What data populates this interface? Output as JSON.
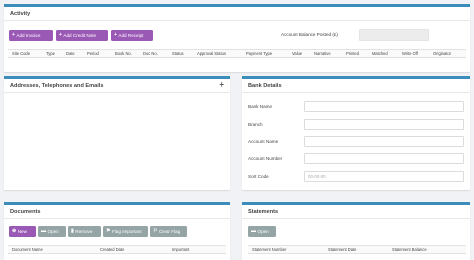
{
  "activity": {
    "title": "Activity",
    "buttons": {
      "add_invoice": "Add Invoice",
      "add_credit_note": "Add Credit Note",
      "add_receipt": "Add Receipt"
    },
    "balance_label": "Account Balance Posted (£)",
    "balance_value": "",
    "columns": [
      "Site Code",
      "Type",
      "Date",
      "Period",
      "Book No.",
      "Doc No.",
      "Status",
      "Approval Status",
      "Payment Type",
      "Value",
      "Narrative",
      "Printed",
      "Matched",
      "Write Off",
      "Originator"
    ]
  },
  "addresses": {
    "title": "Addresses, Telephones and Emails",
    "add_symbol": "+"
  },
  "bank": {
    "title": "Bank Details",
    "fields": [
      {
        "label": "Bank Name",
        "value": "",
        "placeholder": ""
      },
      {
        "label": "Branch",
        "value": "",
        "placeholder": ""
      },
      {
        "label": "Account Name",
        "value": "",
        "placeholder": ""
      },
      {
        "label": "Account Number",
        "value": "",
        "placeholder": ""
      },
      {
        "label": "Sort Code",
        "value": "",
        "placeholder": "00-00-00"
      }
    ]
  },
  "documents": {
    "title": "Documents",
    "buttons": {
      "new": "New",
      "open": "Open",
      "remove": "Remove",
      "flag_important": "Flag Important",
      "clear_flag": "Clear Flag"
    },
    "columns": [
      "Document Name",
      "Created Date",
      "Important"
    ]
  },
  "statements": {
    "title": "Statements",
    "buttons": {
      "open": "Open"
    },
    "columns": [
      "Statement Number",
      "Statement Date",
      "Statement Balance"
    ]
  },
  "colors": {
    "accent": "#3c8dbc",
    "button_primary": "#9b59b6",
    "button_secondary": "#95a5a6"
  }
}
